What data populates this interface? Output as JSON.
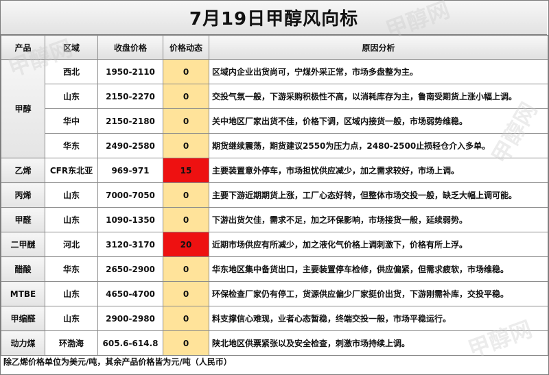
{
  "title": "7月19日甲醇风向标",
  "headers": {
    "product": "产品",
    "region": "区域",
    "price": "收盘价格",
    "change": "价格动态",
    "analysis": "原因分析"
  },
  "rows": [
    {
      "product": "甲醇",
      "region": "西北",
      "price": "1950-2110",
      "change": "0",
      "analysis": "区域内企业出货尚可，宁煤外采正常，市场多盘整为主。"
    },
    {
      "product": "",
      "region": "山东",
      "price": "2150-2270",
      "change": "0",
      "analysis": "交投气氛一般，下游采购积极性不高，以消耗库存为主，鲁南受期货上涨小幅上调。"
    },
    {
      "product": "",
      "region": "华中",
      "price": "2150-2180",
      "change": "0",
      "analysis": "关中地区厂家出货不佳，价格下调，区域内接货一般，市场弱势维稳。"
    },
    {
      "product": "",
      "region": "华东",
      "price": "2490-2580",
      "change": "0",
      "analysis": "期货继续震荡，期货建议2550为压力点，2480-2500止损轻仓介入多单。"
    },
    {
      "product": "乙烯",
      "region": "CFR东北亚",
      "price": "969-971",
      "change": "15",
      "analysis": "主要装置意外停车，市场担忧供应减少，加之需求较好，市场上调。"
    },
    {
      "product": "丙烯",
      "region": "山东",
      "price": "7000-7050",
      "change": "0",
      "analysis": "主要下游近期期货上涨，工厂心态好转，但整体市场交投一般，缺乏大幅上调可能。"
    },
    {
      "product": "甲醛",
      "region": "山东",
      "price": "1090-1350",
      "change": "0",
      "analysis": "下游出货欠佳，需求不足，加之环保影响，市场接货一般，延续弱势。"
    },
    {
      "product": "二甲醚",
      "region": "河北",
      "price": "3120-3170",
      "change": "20",
      "analysis": "近期市场供应有所减少，加之液化气价格上调刺激下，价格有所上浮。"
    },
    {
      "product": "醋酸",
      "region": "华东",
      "price": "2650-2900",
      "change": "0",
      "analysis": "华东地区集中备货出口，主要装置停车检修，供应偏紧，但需求疲软，市场维稳。"
    },
    {
      "product": "MTBE",
      "region": "山东",
      "price": "4650-4700",
      "change": "0",
      "analysis": "环保检查厂家仍有停工，货源供应偏少厂家挺价出货，下游刚需补库，交投平稳。"
    },
    {
      "product": "甲缩醛",
      "region": "山东",
      "price": "2900-2980",
      "change": "0",
      "analysis": "料支撑信心难现，业者心态暂稳，终端交投一般，市场平稳运行。"
    },
    {
      "product": "动力煤",
      "region": "环渤海",
      "price": "605.6-614.8",
      "change": "0",
      "analysis": "陕北地区供票紧张以及安全检查，刺激市场持续上调。"
    }
  ],
  "footnote": "除乙烯价格单位为美元/吨，其余产品价格皆为元/吨（人民币）",
  "watermark": "甲醇网",
  "colors": {
    "up": "#ee1111",
    "flat": "#ffe39a"
  }
}
